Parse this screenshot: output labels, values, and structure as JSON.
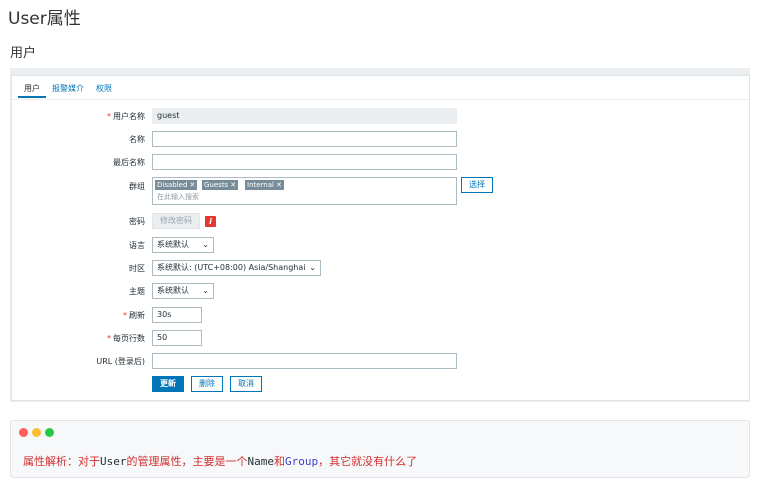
{
  "doc_title": "User属性",
  "page_title": "用户",
  "tabs": [
    {
      "label": "用户",
      "active": true
    },
    {
      "label": "报警媒介",
      "active": false
    },
    {
      "label": "权限",
      "active": false
    }
  ],
  "form": {
    "username": {
      "label": "用户名称",
      "required": true,
      "value": "guest"
    },
    "name": {
      "label": "名称",
      "value": ""
    },
    "surname": {
      "label": "最后名称",
      "value": ""
    },
    "groups": {
      "label": "群组",
      "chips": [
        "Disabled",
        "Guests",
        "Internal"
      ],
      "placeholder": "在此输入搜索",
      "select_label": "选择"
    },
    "password": {
      "label": "密码",
      "button": "修改密码",
      "info_icon": "i"
    },
    "language": {
      "label": "语言",
      "value": "系统默认"
    },
    "timezone": {
      "label": "时区",
      "value": "系统默认: (UTC+08:00) Asia/Shanghai"
    },
    "theme": {
      "label": "主题",
      "value": "系统默认"
    },
    "refresh": {
      "label": "刷新",
      "required": true,
      "value": "30s"
    },
    "rows_per_page": {
      "label": "每页行数",
      "required": true,
      "value": "50"
    },
    "url": {
      "label": "URL (登录后)",
      "value": ""
    }
  },
  "actions": {
    "update": "更新",
    "delete": "删除",
    "cancel": "取消"
  },
  "chip_remove_glyph": "✕",
  "select_chevron": "⌄",
  "note": {
    "dots": [
      "#ff5f56",
      "#ffbd2e",
      "#27c93f"
    ],
    "part1": "属性解析：对于",
    "user": "User",
    "part2": "的管理属性，主要是一个",
    "name": "Name",
    "and": "和",
    "group": "Group",
    "part3": "，其它就没有什么了"
  },
  "colors": {
    "accent": "#0275b8",
    "required": "#e33734",
    "chip": "#768d99"
  }
}
